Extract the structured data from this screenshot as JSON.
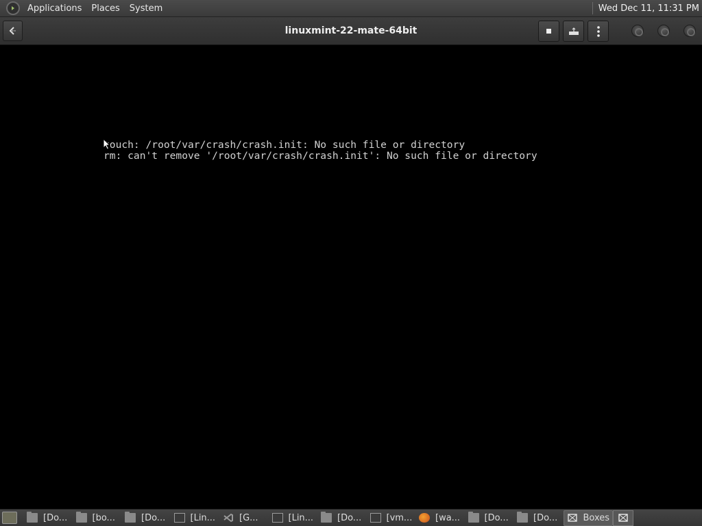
{
  "top_panel": {
    "menus": [
      "Applications",
      "Places",
      "System"
    ],
    "clock": "Wed Dec 11, 11:31 PM",
    "menu_icon": "mint-logo-icon"
  },
  "headerbar": {
    "title": "linuxmint-22-mate-64bit",
    "back_icon": "back-arrow-icon",
    "buttons": [
      "stop-icon",
      "keyboard-icon",
      "kebab-menu-icon"
    ],
    "window_buttons": [
      "minimize-icon",
      "maximize-icon",
      "close-icon"
    ]
  },
  "console": {
    "lines": [
      "touch: /root/var/crash/crash.init: No such file or directory",
      "rm: can't remove '/root/var/crash/crash.init': No such file or directory"
    ]
  },
  "taskbar": {
    "show_desktop_label": "",
    "tasks": [
      {
        "label": "[Do...",
        "icon": "folder-icon"
      },
      {
        "label": "[bo...",
        "icon": "folder-icon"
      },
      {
        "label": "[Do...",
        "icon": "folder-icon"
      },
      {
        "label": "[Lin...",
        "icon": "terminal-icon"
      },
      {
        "label": "[G...",
        "icon": "vscode-icon"
      },
      {
        "label": "[Lin...",
        "icon": "terminal-icon"
      },
      {
        "label": "[Do...",
        "icon": "folder-icon"
      },
      {
        "label": "[vm...",
        "icon": "terminal-icon"
      },
      {
        "label": "[wa...",
        "icon": "firefox-icon"
      },
      {
        "label": "[Do...",
        "icon": "folder-icon"
      },
      {
        "label": "[Do...",
        "icon": "folder-icon"
      },
      {
        "label": "Boxes",
        "icon": "boxes-icon",
        "active": true
      }
    ]
  },
  "colors": {
    "panel": "#3d3d3d",
    "console_text": "#d2d2d2",
    "background": "#000000"
  }
}
